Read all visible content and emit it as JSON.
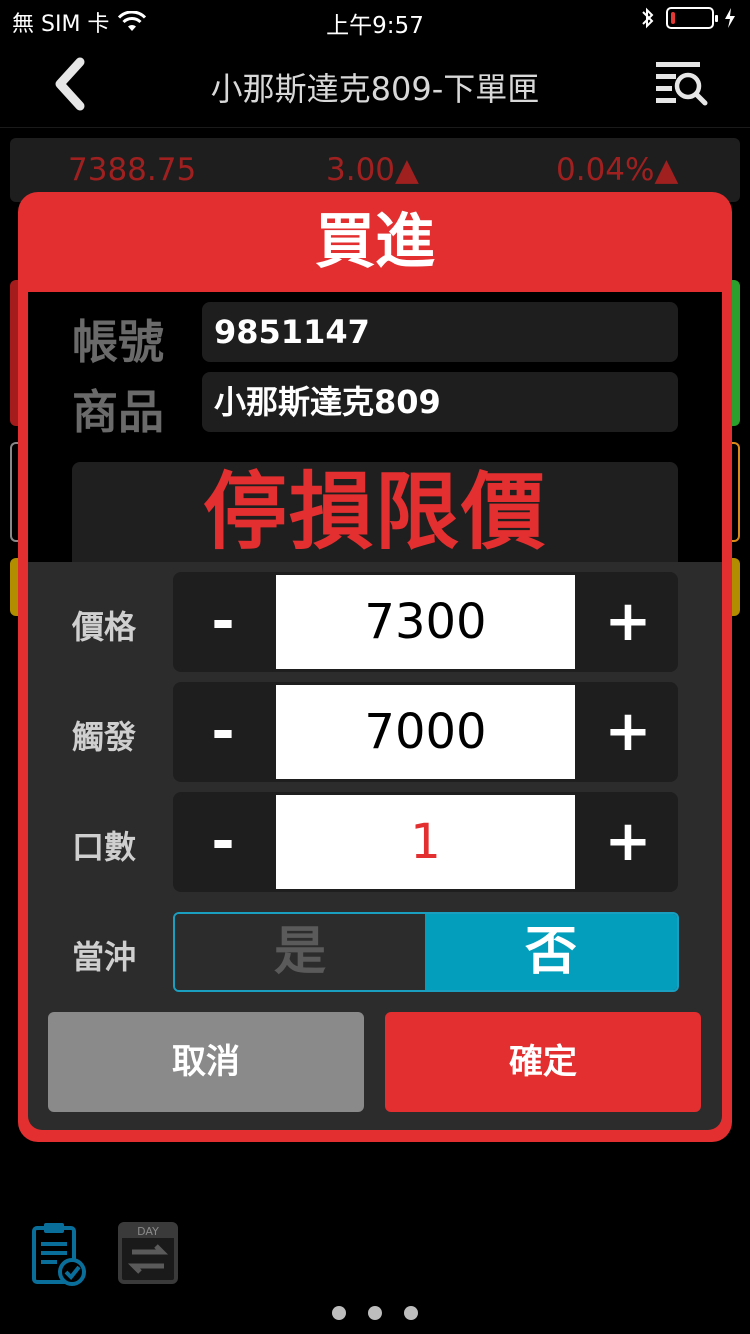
{
  "status_bar": {
    "carrier": "無 SIM 卡",
    "time": "上午9:57",
    "battery_level": 0.1
  },
  "nav": {
    "title": "小那斯達克809-下單匣"
  },
  "quote": {
    "price": "7388.75",
    "change": "3.00▲",
    "change_percent": "0.04%▲"
  },
  "order_dialog": {
    "title": "買進",
    "account_label": "帳號",
    "account_value": "9851147",
    "product_label": "商品",
    "product_value": "小那斯達克809",
    "order_type": "停損限價",
    "price": {
      "label": "價格",
      "value": "7300",
      "minus": "-",
      "plus": "+"
    },
    "trigger": {
      "label": "觸發",
      "value": "7000",
      "minus": "-",
      "plus": "+"
    },
    "lots": {
      "label": "口數",
      "value": "1",
      "minus": "-",
      "plus": "+"
    },
    "day_trade": {
      "label": "當沖",
      "yes": "是",
      "no": "否",
      "selected": "否"
    },
    "cancel_label": "取消",
    "confirm_label": "確定"
  },
  "bottom": {
    "day_label": "DAY",
    "page_count": 3
  },
  "colors": {
    "accent_red": "#e32f2f",
    "toggle_blue": "#049ebd",
    "quote_red": "#a02020"
  }
}
